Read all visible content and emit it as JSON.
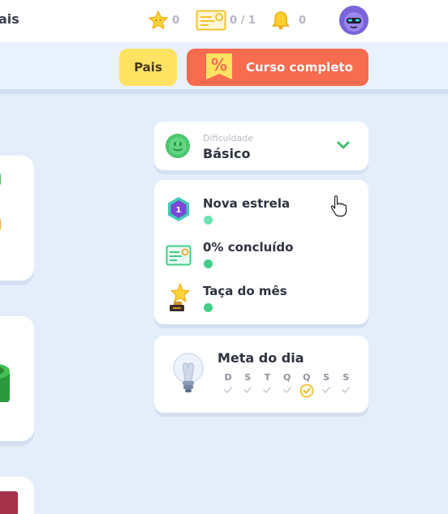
{
  "topbar": {
    "title_fragment": "ais",
    "stars": {
      "icon": "star-icon",
      "value": "0"
    },
    "certificates": {
      "icon": "certificate-icon",
      "value": "0 / 1"
    },
    "notifications": {
      "icon": "bell-icon",
      "value": "0"
    },
    "avatar": "robot-avatar-icon"
  },
  "subbar": {
    "pais_label": "Pais",
    "curso_label": "Curso completo",
    "curso_icon": "percent-tag-icon"
  },
  "difficulty": {
    "caption": "Dificuldade",
    "value": "Básico"
  },
  "goals": [
    {
      "icon": "hexagon-star-1-icon",
      "label": "Nova estrela"
    },
    {
      "icon": "certificate-icon",
      "label": "0% concluído"
    },
    {
      "icon": "trophy-star-icon",
      "label": "Taça do mês"
    }
  ],
  "daily_goal": {
    "title": "Meta do dia",
    "days": [
      "D",
      "S",
      "T",
      "Q",
      "Q",
      "S",
      "S"
    ],
    "current_day_index": 4
  },
  "colors": {
    "accent_yellow": "#ffe262",
    "accent_orange": "#f76b4f",
    "success_green": "#3fcf86",
    "background": "#e4eefb"
  }
}
